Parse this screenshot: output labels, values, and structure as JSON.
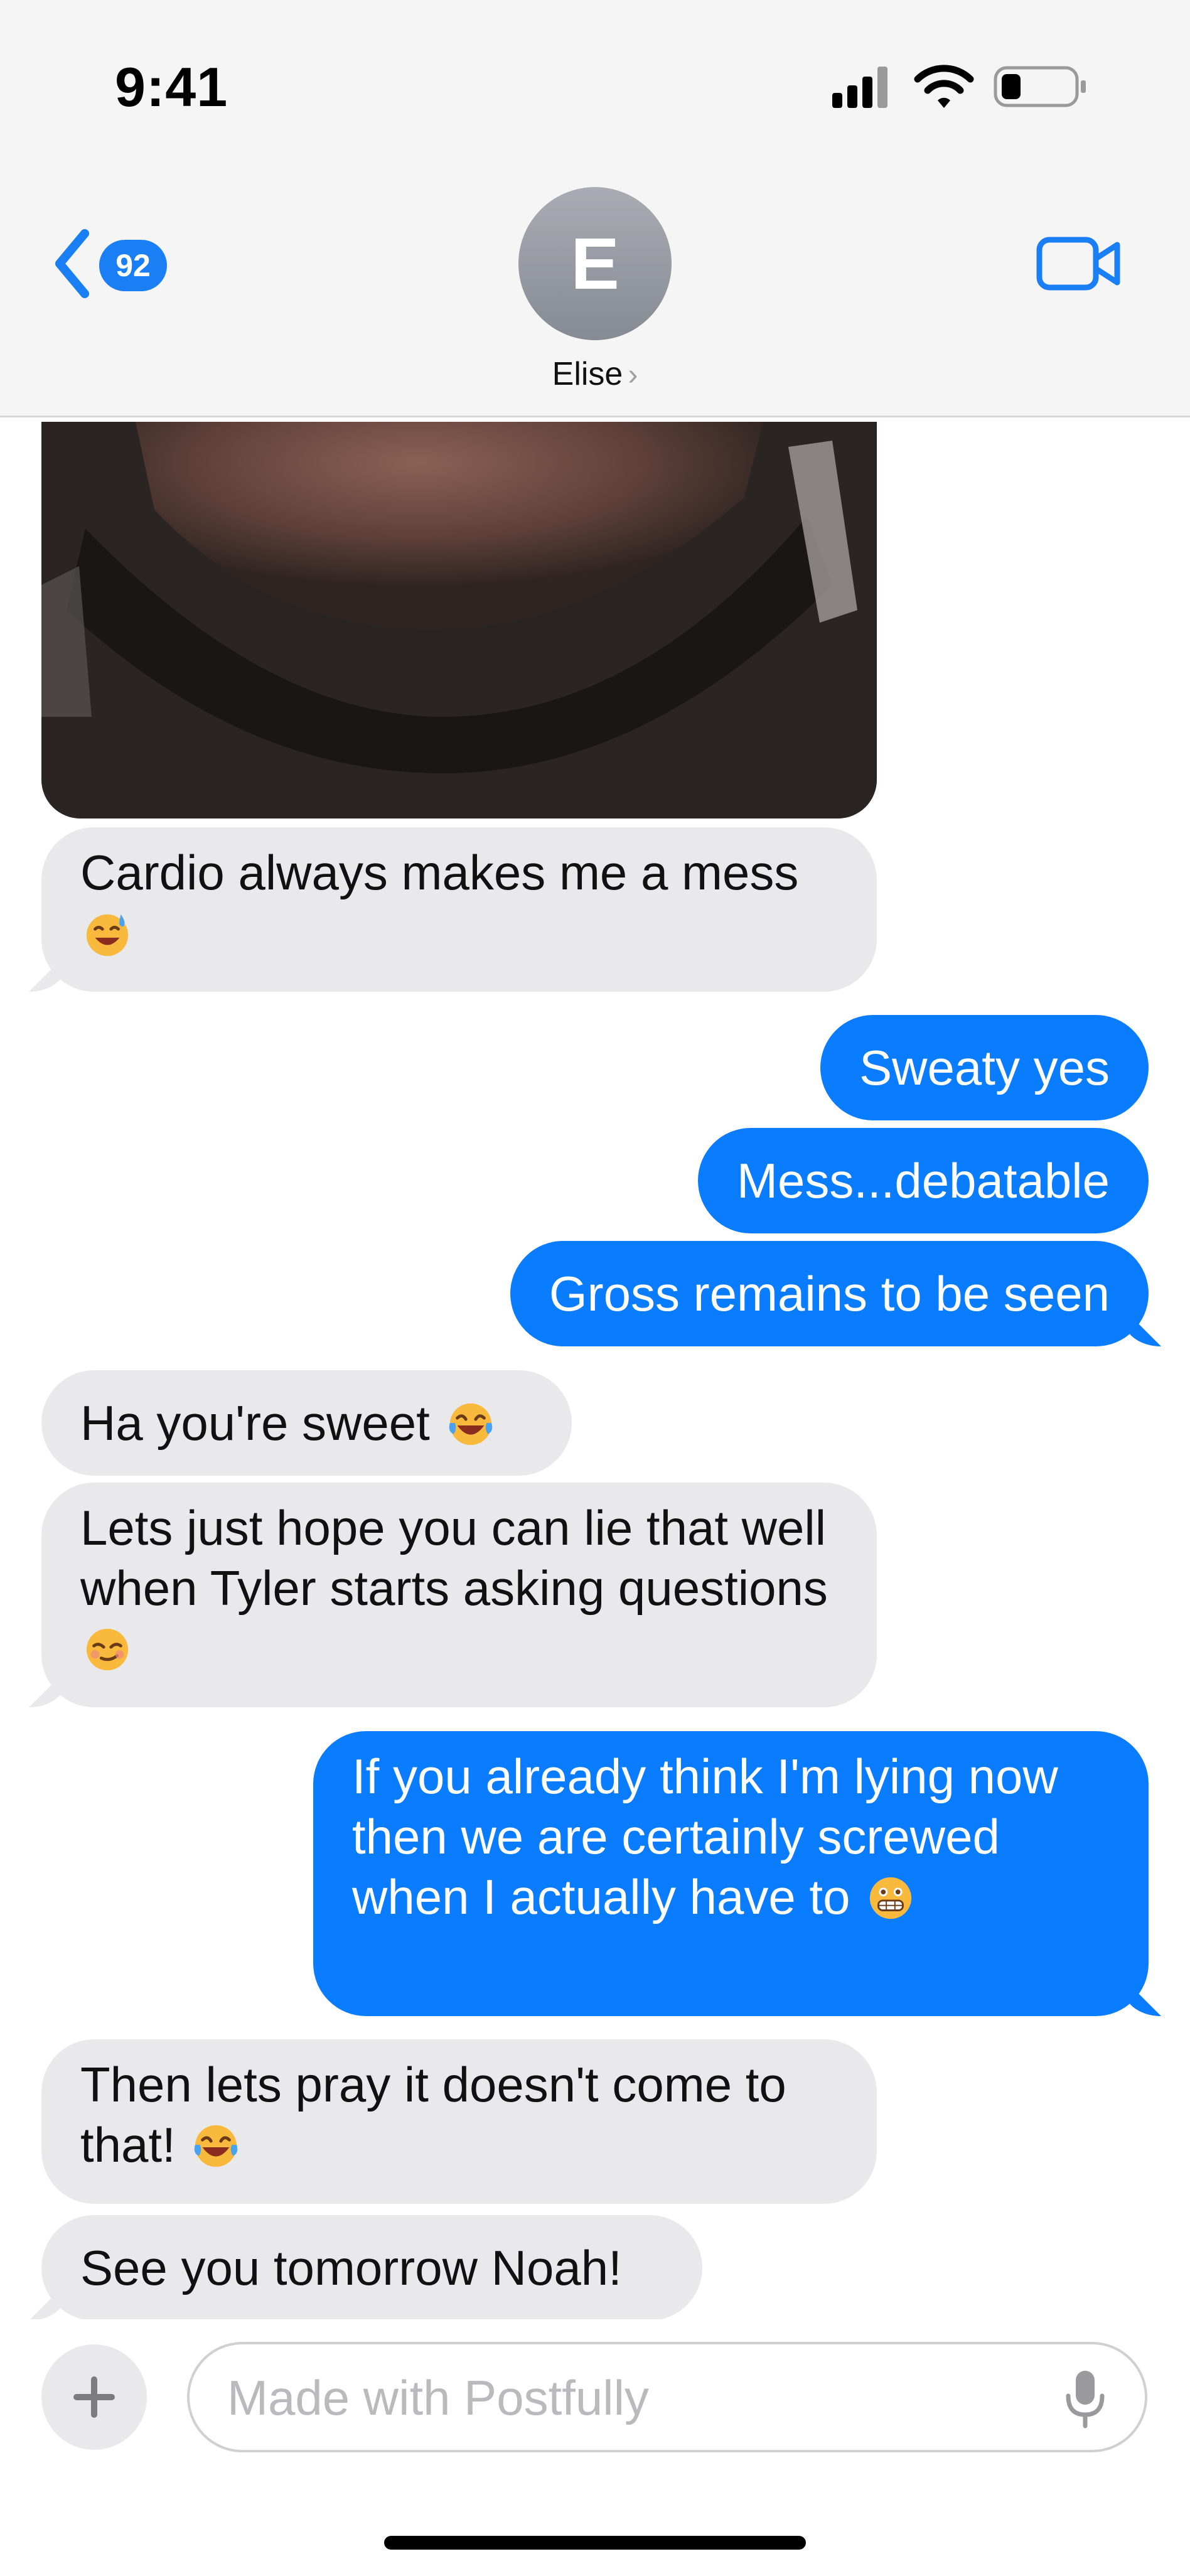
{
  "status_bar": {
    "time": "9:41"
  },
  "header": {
    "back_badge": "92",
    "avatar_initial": "E",
    "contact_name": "Elise",
    "contact_chevron": "›"
  },
  "messages": [
    {
      "from": "them",
      "text": "Cardio always makes me a mess",
      "emoji": "sweat-smile-emoji"
    },
    {
      "from": "me",
      "text": "Sweaty yes"
    },
    {
      "from": "me",
      "text": "Mess...debatable"
    },
    {
      "from": "me",
      "text": "Gross remains to be seen"
    },
    {
      "from": "them",
      "text": "Ha you're sweet",
      "emoji": "tears-of-joy-emoji"
    },
    {
      "from": "them",
      "text": "Lets just hope you can lie that well when Tyler starts asking questions",
      "emoji": "smirk-emoji"
    },
    {
      "from": "me",
      "text": "If you already think I'm lying now then we are certainly screwed when I actually have to",
      "emoji": "grimace-emoji"
    },
    {
      "from": "them",
      "text": "Then lets pray it doesn't come to that!",
      "emoji": "tears-of-joy-emoji"
    },
    {
      "from": "them",
      "text": "See you tomorrow Noah!"
    }
  ],
  "composer": {
    "placeholder": "Made with Postfully"
  },
  "colors": {
    "accent": "#0a7cff",
    "incoming_bubble": "#e9e9eb"
  }
}
